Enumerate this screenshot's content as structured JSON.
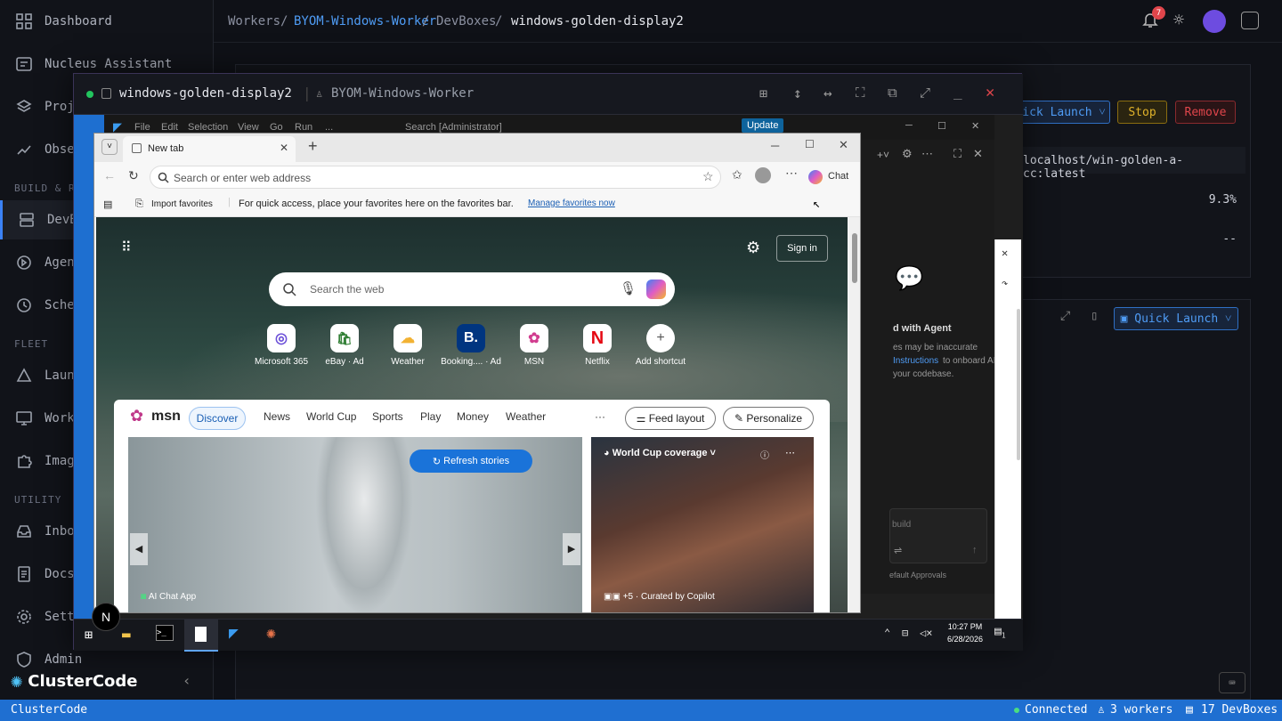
{
  "sidebar": {
    "items": [
      {
        "label": "Dashboard",
        "icon": "dashboard-icon"
      },
      {
        "label": "Nucleus Assistant",
        "icon": "assistant-icon"
      },
      {
        "label": "Projects",
        "icon": "layers-icon"
      },
      {
        "label": "Observability",
        "icon": "observe-icon"
      },
      {
        "label": "DevBoxes",
        "icon": "server-icon"
      },
      {
        "label": "Agents",
        "icon": "agent-icon"
      },
      {
        "label": "Schedules",
        "icon": "clock-icon"
      },
      {
        "label": "Launch",
        "icon": "triangle-icon"
      },
      {
        "label": "Workers",
        "icon": "monitor-icon"
      },
      {
        "label": "Images",
        "icon": "puzzle-icon"
      },
      {
        "label": "Inbox",
        "icon": "inbox-icon"
      },
      {
        "label": "Docs",
        "icon": "doc-icon"
      },
      {
        "label": "Settings",
        "icon": "gear-icon"
      },
      {
        "label": "Admin",
        "icon": "shield-icon"
      }
    ],
    "sections": {
      "build": "BUILD & RUN",
      "fleet": "FLEET",
      "utility": "UTILITY"
    },
    "logo": "ClusterCode"
  },
  "breadcrumb": {
    "a": "Workers",
    "b": "BYOM-Windows-Worker",
    "c": "DevBoxes",
    "current": "windows-golden-display2",
    "sep": "/"
  },
  "topbar": {
    "notif_count": "7"
  },
  "background": {
    "quick_launch": "ick Launch",
    "stop": "Stop",
    "remove": "Remove",
    "image_value": "localhost/win-golden-a-cc:latest",
    "cpu": "9.3%",
    "dash": "--",
    "quick_launch2": "Quick Launch"
  },
  "remote": {
    "title": "windows-golden-display2",
    "worker": "BYOM-Windows-Worker",
    "clock_time": "10:27 PM",
    "clock_date": "6/28/2026",
    "notif": "1"
  },
  "vscode": {
    "menu": [
      "File",
      "Edit",
      "Selection",
      "View",
      "Go",
      "Run",
      "..."
    ],
    "search": "Search [Administrator]",
    "update": "Update",
    "agent_title": "d with Agent",
    "agent_l1": "es may be inaccurate",
    "agent_l2a": "Instructions",
    "agent_l2b": " to onboard AI",
    "agent_l3": "your codebase.",
    "build": "build",
    "approvals": "efault Approvals"
  },
  "edge": {
    "tab_title": "New tab",
    "address_placeholder": "Search or enter web address",
    "chat": "Chat",
    "import_fav": "Import favorites",
    "fav_text": "For quick access, place your favorites here on the favorites bar.",
    "fav_link": "Manage favorites now",
    "sign_in": "Sign in",
    "search_placeholder": "Search the web",
    "tiles": [
      {
        "label": "Microsoft 365",
        "glyph": "◎",
        "color": "#6b4fd8"
      },
      {
        "label": "eBay · Ad",
        "glyph": "🛍",
        "color": "#2e7d32"
      },
      {
        "label": "Weather",
        "glyph": "☁",
        "color": "#f2b233"
      },
      {
        "label": "Booking.... · Ad",
        "glyph": "B.",
        "color": "#003580"
      },
      {
        "label": "MSN",
        "glyph": "✿",
        "color": "#d13d8f"
      },
      {
        "label": "Netflix",
        "glyph": "N",
        "color": "#e50914"
      },
      {
        "label": "Add shortcut",
        "glyph": "+",
        "color": "#555"
      }
    ],
    "msn_logo": "msn",
    "msn_tabs": [
      "Discover",
      "News",
      "World Cup",
      "Sports",
      "Play",
      "Money",
      "Weather",
      "···"
    ],
    "feed_layout": "Feed layout",
    "personalize": "Personalize",
    "refresh": "Refresh stories",
    "card1_source": "AI Chat App",
    "card2_title": "World Cup coverage",
    "card2_source": "+5 · Curated by Copilot"
  },
  "status": {
    "app": "ClusterCode",
    "connected": "Connected",
    "workers": "3 workers",
    "devboxes": "17 DevBoxes"
  },
  "colors": {
    "accent": "#3b82f6",
    "status_bar": "#1f6fd1",
    "stop": "#d4a017",
    "remove": "#e0454b"
  }
}
